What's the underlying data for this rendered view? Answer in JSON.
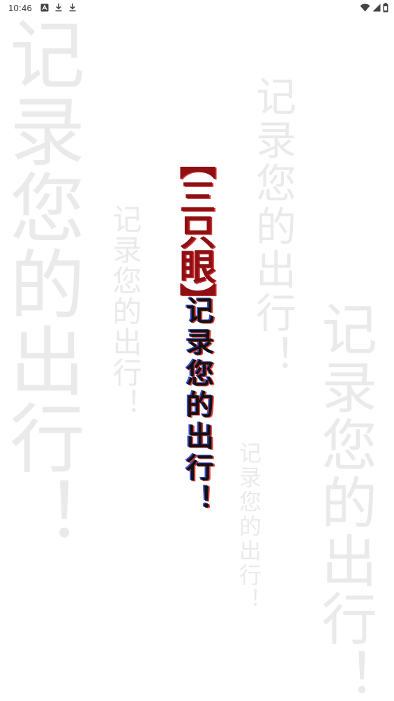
{
  "status_bar": {
    "time": "10:46",
    "left_icons": [
      "notification-a-icon",
      "download-icon",
      "download-icon"
    ],
    "right_icons": [
      "wifi-icon",
      "signal-icon",
      "battery-icon"
    ]
  },
  "splash": {
    "brand": "【三只眼】",
    "slogan": "记录您的出行！",
    "background_slogans": [
      "记录您的出行！",
      "记录您的出行！",
      "记录您的出行！",
      "记录您的出行！",
      "记录您的出行！"
    ]
  },
  "colors": {
    "brand_red": "#8e1014",
    "slogan_text": "#111111",
    "background_text": "#bebebe",
    "page_background": "#ffffff"
  }
}
